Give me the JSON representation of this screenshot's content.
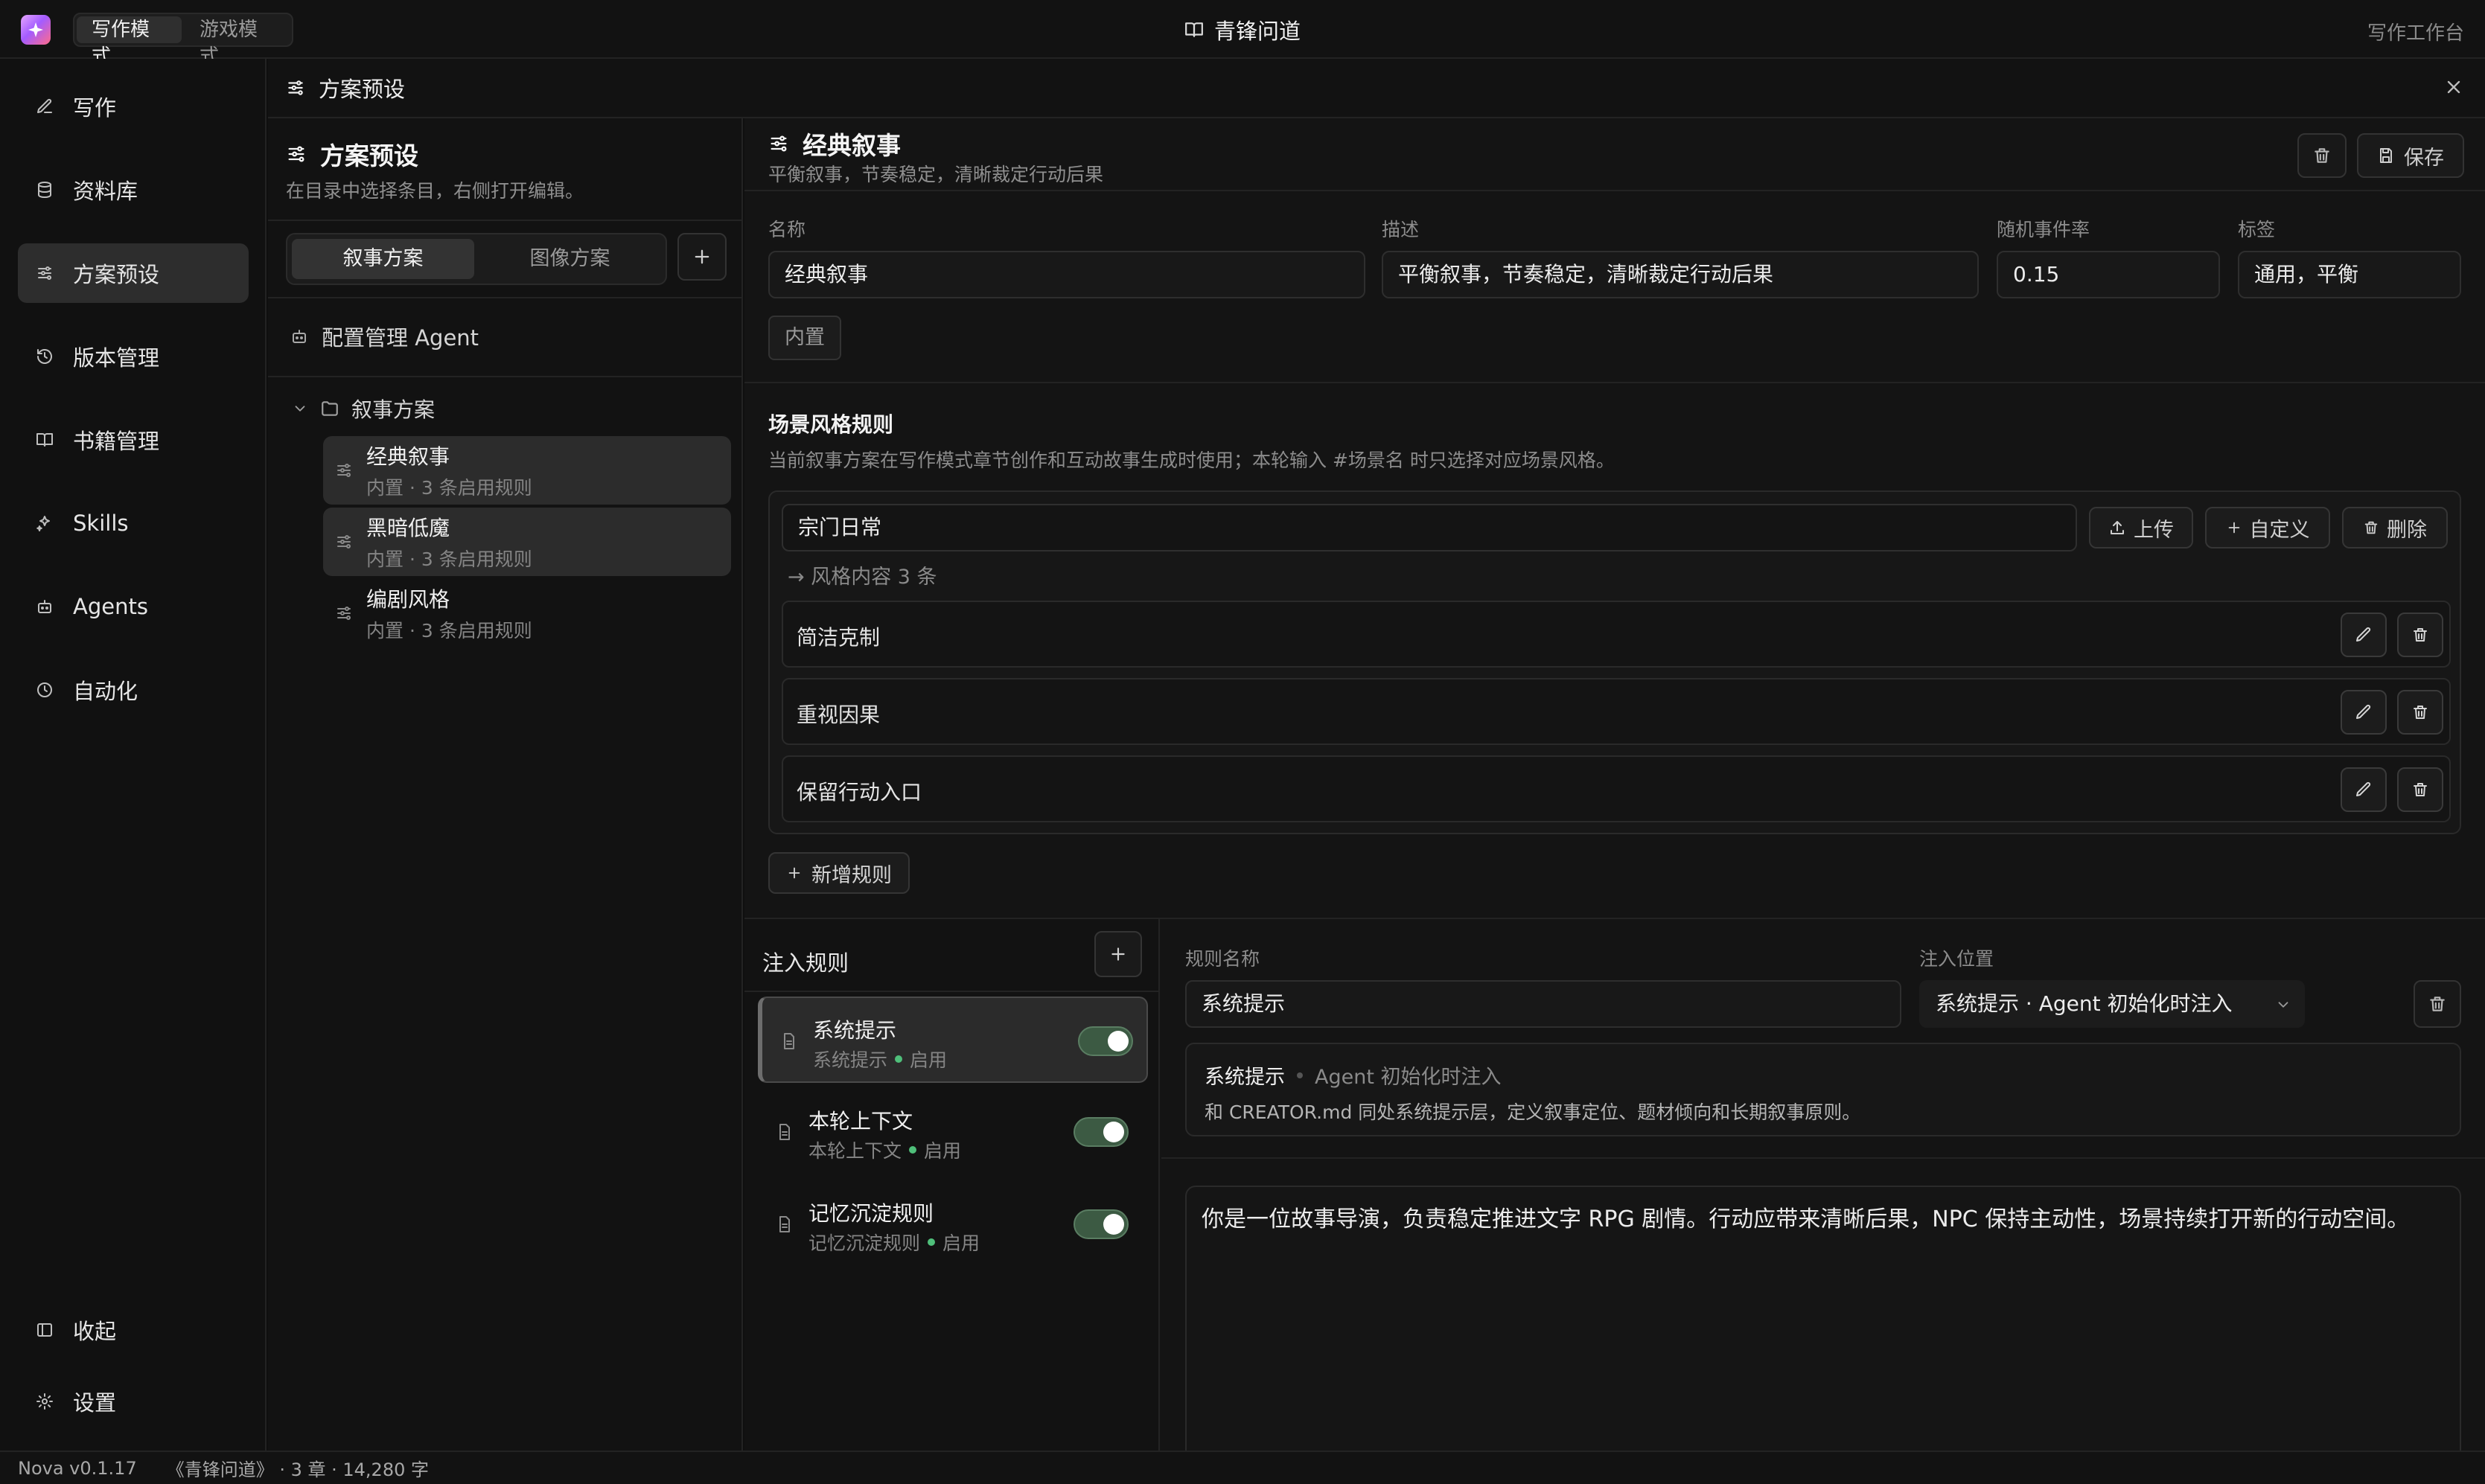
{
  "topbar": {
    "modes": [
      "写作模式",
      "游戏模式"
    ],
    "active_mode": "写作模式",
    "doc_title": "青锋问道",
    "workspace_label": "写作工作台"
  },
  "nav": {
    "items": [
      {
        "label": "写作",
        "icon": "pen-icon"
      },
      {
        "label": "资料库",
        "icon": "database-icon"
      },
      {
        "label": "方案预设",
        "icon": "sliders-icon",
        "active": true
      },
      {
        "label": "版本管理",
        "icon": "history-icon"
      },
      {
        "label": "书籍管理",
        "icon": "book-icon"
      },
      {
        "label": "Skills",
        "icon": "sparkles-icon"
      },
      {
        "label": "Agents",
        "icon": "bot-icon"
      },
      {
        "label": "自动化",
        "icon": "clock-icon"
      }
    ],
    "collapse_label": "收起",
    "settings_label": "设置"
  },
  "panel": {
    "title": "方案预设"
  },
  "middle": {
    "title": "方案预设",
    "subtitle": "在目录中选择条目，右侧打开编辑。",
    "tabs": [
      "叙事方案",
      "图像方案"
    ],
    "active_tab": "叙事方案",
    "agent_label": "配置管理 Agent",
    "folder_label": "叙事方案",
    "presets": [
      {
        "name": "经典叙事",
        "meta": "内置 · 3 条启用规则",
        "selected": true
      },
      {
        "name": "黑暗低魔",
        "meta": "内置 · 3 条启用规则",
        "selected": true
      },
      {
        "name": "编剧风格",
        "meta": "内置 · 3 条启用规则",
        "selected": false
      }
    ]
  },
  "editor": {
    "title": "经典叙事",
    "subtitle": "平衡叙事，节奏稳定，清晰裁定行动后果",
    "save_label": "保存",
    "fields": {
      "name_label": "名称",
      "name_value": "经典叙事",
      "desc_label": "描述",
      "desc_value": "平衡叙事，节奏稳定，清晰裁定行动后果",
      "rate_label": "随机事件率",
      "rate_value": "0.15",
      "tags_label": "标签",
      "tags_value": "通用，平衡"
    },
    "builtin_tag": "内置",
    "scene_section": {
      "title": "场景风格规则",
      "desc": "当前叙事方案在写作模式章节创作和互动故事生成时使用；本轮输入 #场景名 时只选择对应场景风格。",
      "scene_name": "宗门日常",
      "upload_label": "上传",
      "custom_label": "自定义",
      "delete_label": "删除",
      "count_label": "→ 风格内容 3 条",
      "rules": [
        "简洁克制",
        "重视因果",
        "保留行动入口"
      ],
      "add_rule_label": "新增规则"
    },
    "inject": {
      "header": "注入规则",
      "items": [
        {
          "name": "系统提示",
          "meta": "系统提示",
          "status": "启用",
          "enabled": true,
          "selected": true
        },
        {
          "name": "本轮上下文",
          "meta": "本轮上下文",
          "status": "启用",
          "enabled": true,
          "selected": false
        },
        {
          "name": "记忆沉淀规则",
          "meta": "记忆沉淀规则",
          "status": "启用",
          "enabled": true,
          "selected": false
        }
      ],
      "rule_name_label": "规则名称",
      "rule_name_value": "系统提示",
      "position_label": "注入位置",
      "position_value": "系统提示 · Agent 初始化时注入",
      "info_title": "系统提示",
      "info_subtitle": "Agent 初始化时注入",
      "info_desc": "和 CREATOR.md 同处系统提示层，定义叙事定位、题材倾向和长期叙事原则。",
      "prompt_text": "你是一位故事导演，负责稳定推进文字 RPG 剧情。行动应带来清晰后果，NPC 保持主动性，场景持续打开新的行动空间。"
    }
  },
  "status": {
    "version": "Nova v0.1.17",
    "book_info": "《青锋问道》 · 3 章 · 14,280 字"
  },
  "colors": {
    "accent_green": "#4fbf7a",
    "toggle_on": "#3c5a43",
    "bg": "#0f0f0f"
  }
}
